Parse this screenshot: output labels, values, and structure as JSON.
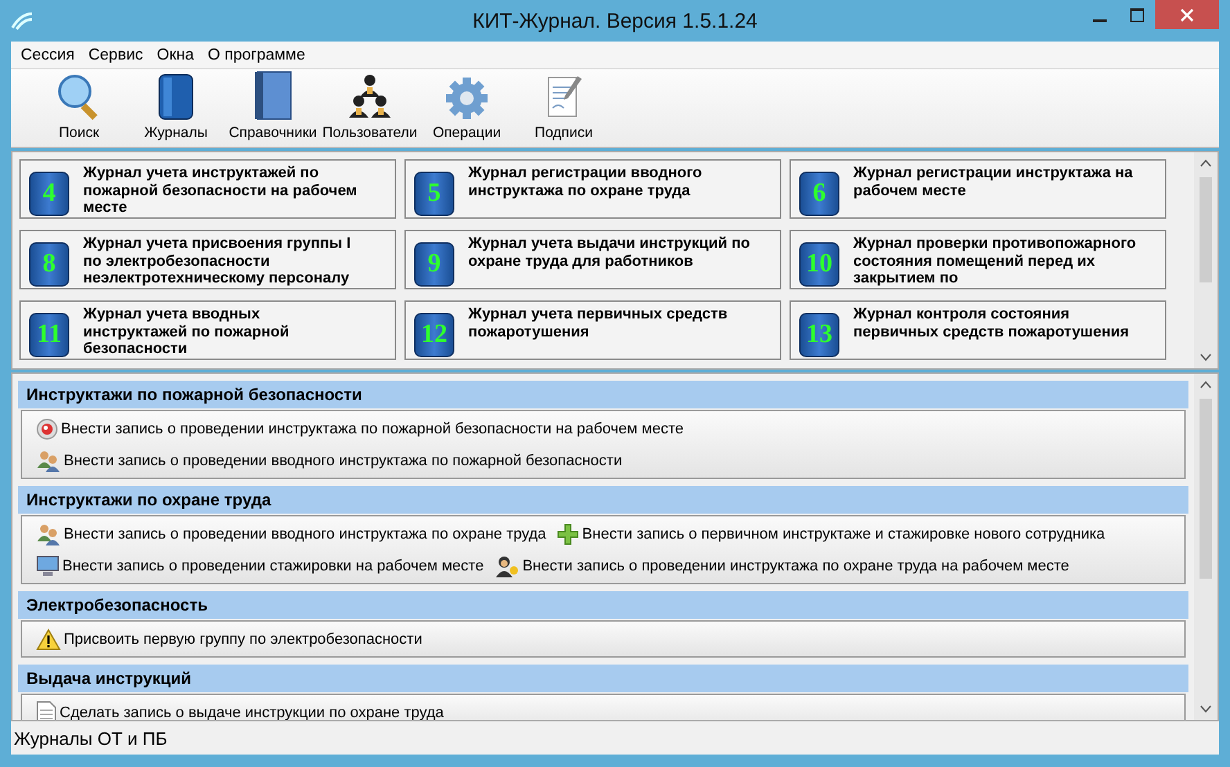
{
  "window": {
    "title": "КИТ-Журнал. Версия 1.5.1.24"
  },
  "menu": [
    "Сессия",
    "Сервис",
    "Окна",
    "О программе"
  ],
  "toolbar": [
    {
      "label": "Поиск",
      "kind": "search"
    },
    {
      "label": "Журналы",
      "kind": "journal"
    },
    {
      "label": "Справочники",
      "kind": "binder"
    },
    {
      "label": "Пользователи",
      "kind": "users"
    },
    {
      "label": "Операции",
      "kind": "gear"
    },
    {
      "label": "Подписи",
      "kind": "signature"
    }
  ],
  "journals": [
    {
      "number": "4",
      "title": "Журнал учета инструктажей по пожарной безопасности на рабочем месте"
    },
    {
      "number": "5",
      "title": "Журнал регистрации вводного инструктажа по охране труда"
    },
    {
      "number": "6",
      "title": "Журнал регистрации инструктажа на рабочем месте"
    },
    {
      "number": "8",
      "title": "Журнал учета присвоения группы I по электробезопасности неэлектротехническому персоналу"
    },
    {
      "number": "9",
      "title": "Журнал учета выдачи инструкций по охране труда для работников"
    },
    {
      "number": "10",
      "title": "Журнал проверки противопожарного состояния помещений перед их закрытием по"
    },
    {
      "number": "11",
      "title": "Журнал учета вводных инструктажей по пожарной безопасности"
    },
    {
      "number": "12",
      "title": "Журнал учета первичных средств пожаротушения"
    },
    {
      "number": "13",
      "title": "Журнал контроля состояния первичных средств пожаротушения"
    }
  ],
  "sections": [
    {
      "title": "Инструктажи по пожарной безопасности",
      "rows": [
        [
          {
            "kind": "disc",
            "label": "Внести запись о проведении инструктажа по пожарной безопасности на рабочем месте"
          }
        ],
        [
          {
            "kind": "people",
            "label": "Внести запись о проведении вводного инструктажа по пожарной безопасности"
          }
        ]
      ]
    },
    {
      "title": "Инструктажи по охране труда",
      "rows": [
        [
          {
            "kind": "people",
            "label": "Внести запись о проведении вводного инструктажа по охране труда"
          },
          {
            "kind": "plus",
            "label": "Внести запись о первичном инструктаже и стажировке нового сотрудника"
          }
        ],
        [
          {
            "kind": "monitor",
            "label": "Внести запись о проведении стажировки на рабочем месте"
          },
          {
            "kind": "person-key",
            "label": "Внести запись о проведении инструктажа по охране труда на рабочем месте"
          }
        ]
      ]
    },
    {
      "title": "Электробезопасность",
      "rows": [
        [
          {
            "kind": "warning",
            "label": "Присвоить первую группу по электробезопасности"
          }
        ]
      ]
    },
    {
      "title": "Выдача инструкций",
      "rows": [
        [
          {
            "kind": "document",
            "label": "Сделать запись о выдаче инструкции по охране труда"
          }
        ]
      ]
    }
  ],
  "status_bar": "Журналы ОТ и ПБ"
}
